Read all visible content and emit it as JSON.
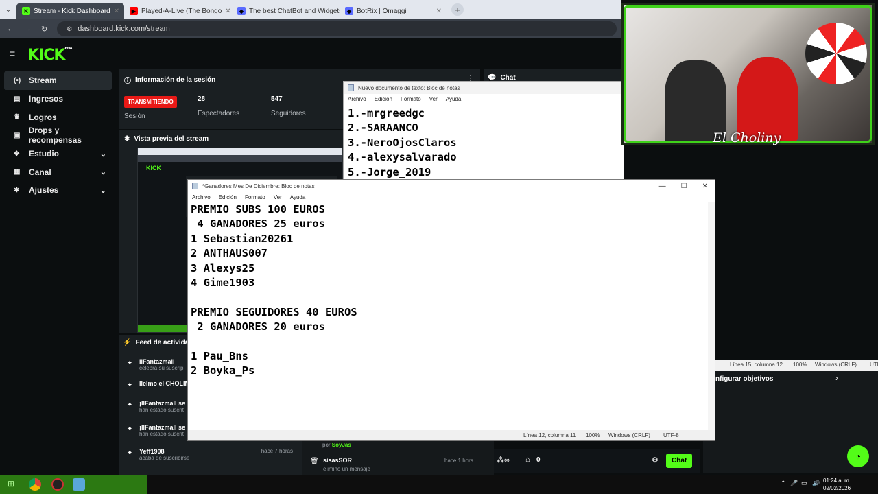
{
  "browser": {
    "tabs": [
      {
        "title": "Stream - Kick Dashboard",
        "fav": "K",
        "color": "#53fc18"
      },
      {
        "title": "Played-A-Live (The Bongo",
        "fav": "▶",
        "color": "#ff0000"
      },
      {
        "title": "The best ChatBot and Widgets",
        "fav": "◆",
        "color": "#5a6bff"
      },
      {
        "title": "BotRix | Omaggi",
        "fav": "◆",
        "color": "#5a6bff"
      }
    ],
    "url": "dashboard.kick.com/stream"
  },
  "sidebar": {
    "items": [
      {
        "label": "Stream",
        "icon": "broadcast-icon",
        "glyph": "(•)",
        "active": true
      },
      {
        "label": "Ingresos",
        "icon": "wallet-icon",
        "glyph": "▤"
      },
      {
        "label": "Logros",
        "icon": "trophy-icon",
        "glyph": "♛"
      },
      {
        "label": "Drops y recompensas",
        "icon": "gift-icon",
        "glyph": "▣"
      },
      {
        "label": "Estudio",
        "icon": "layers-icon",
        "glyph": "✥",
        "chev": "⌄"
      },
      {
        "label": "Canal",
        "icon": "grid-icon",
        "glyph": "▦",
        "chev": "⌄"
      },
      {
        "label": "Ajustes",
        "icon": "gear-icon",
        "glyph": "✱",
        "chev": "⌄"
      }
    ]
  },
  "session": {
    "title": "Información de la sesión",
    "live_badge": "TRANSMITIENDO",
    "session_label": "Sesión",
    "viewers": "28",
    "viewers_label": "Espectadores",
    "followers": "547",
    "followers_label": "Seguidores"
  },
  "preview": {
    "title": "Vista previa del stream"
  },
  "activity": {
    "title": "Feed de actividad",
    "items": [
      {
        "name": "llFantazmall",
        "sub": "celebra su suscrip"
      },
      {
        "name": "llelmo el CHOLINY",
        "sub": ""
      },
      {
        "name": "¡llFantazmall se",
        "sub": "han estado suscrit"
      },
      {
        "name": "¡llFantazmall se",
        "sub": "han estado suscrit"
      },
      {
        "name": "Yeff1908",
        "sub": "acaba de suscribirse",
        "time": "hace 7 horas"
      }
    ]
  },
  "chat": {
    "title": "Chat",
    "feed": [
      {
        "by": "por",
        "name": "SoyJas"
      },
      {
        "name": "sisasSOR",
        "sub": "eliminó un mensaje",
        "time": "hace 1 hora"
      }
    ],
    "send": "Chat",
    "count": "0"
  },
  "goals": {
    "label": "nfigurar objetivos"
  },
  "notepad1": {
    "title": "Nuevo documento de texto: Bloc de notas",
    "menu": [
      "Archivo",
      "Edición",
      "Formato",
      "Ver",
      "Ayuda"
    ],
    "lines": [
      "1.-mrgreedgc",
      "2.-SARAANCO",
      "3.-NeroOjosClaros",
      "4.-alexysalvarado",
      "5.-Jorge_2019"
    ],
    "status": [
      "Línea 15, columna 12",
      "100%",
      "Windows (CRLF)",
      "UTF"
    ]
  },
  "notepad2": {
    "title": "*Ganadores Mes De Diciembre: Bloc de notas",
    "menu": [
      "Archivo",
      "Edición",
      "Formato",
      "Ver",
      "Ayuda"
    ],
    "content": "PREMIO SUBS 100 EUROS\n 4 GANADORES 25 euros\n1 Sebastian20261\n2 ANTHAUS007\n3 Alexys25\n4 Gime1903\n\nPREMIO SEGUIDORES 40 EUROS\n 2 GANADORES 20 euros\n\n1 Pau_Bns\n2 Boyka_Ps",
    "status": [
      "Línea 12, columna 11",
      "100%",
      "Windows (CRLF)",
      "UTF-8"
    ]
  },
  "webcam": {
    "caption": "El Choliny"
  },
  "taskbar": {
    "time": "01:24 a. m.",
    "date": "02/02/2026"
  }
}
